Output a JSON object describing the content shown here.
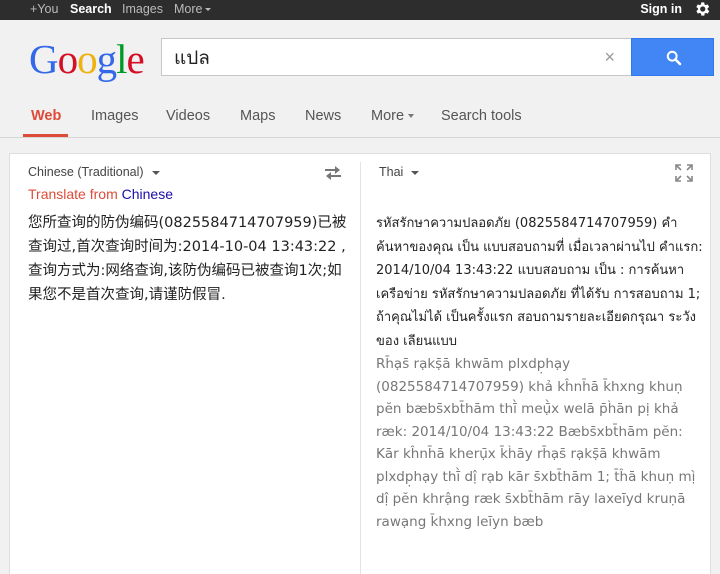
{
  "topbar": {
    "items": [
      "+You",
      "Search",
      "Images",
      "More"
    ],
    "signin": "Sign in"
  },
  "logo": {
    "letters": [
      {
        "char": "G",
        "color": "#3369e8"
      },
      {
        "char": "o",
        "color": "#d50f25"
      },
      {
        "char": "o",
        "color": "#eeb211"
      },
      {
        "char": "g",
        "color": "#3369e8"
      },
      {
        "char": "l",
        "color": "#009925"
      },
      {
        "char": "e",
        "color": "#d50f25"
      }
    ]
  },
  "search": {
    "query": "แปล",
    "clear_glyph": "×",
    "button_icon": "magnifier-icon"
  },
  "tabs": {
    "items": [
      "Web",
      "Images",
      "Videos",
      "Maps",
      "News",
      "More",
      "Search tools"
    ],
    "active": "Web"
  },
  "translate": {
    "source_language": "Chinese (Traditional)",
    "target_language": "Thai",
    "translate_from_prefix": "Translate from",
    "translate_from_language": "Chinese",
    "source_text": "您所查询的防伪编码(0825584714707959)已被查询过,首次查询时间为:2014-10-04 13:43:22 ,查询方式为:网络查询,该防伪编码已被查询1次;如果您不是首次查询,请谨防假冒.",
    "target_text": "รหัสรักษาความปลอดภัย (0825584714707959) คำค้นหาของคุณ เป็น แบบสอบถามที่ เมื่อเวลาผ่านไป คำแรก: 2014/10/04 13:43:22 แบบสอบถาม เป็น : การค้นหาเครือข่าย รหัสรักษาความปลอดภัย ที่ได้รับ การสอบถาม 1; ถ้าคุณไม่ได้ เป็นครั้งแรก สอบถามรายละเอียดกรุณา ระวังของ เลียนแบบ",
    "transliteration": "Rh̄ạs̄ rạkṣ̄ā khwām plxdp̣hạy (0825584714707959) khả kĥnh̄ā k̄hxng khuṇ pĕn bæbs̄xbt̄hām thī̀ meụ̄̀x welā p̄h̀ān pị khả ræk: 2014/10/04 13:43:22 Bæbs̄xbt̄hām pĕn: Kār kĥnh̄ā kherụ̄x k̄h̀āy rh̄ạs̄ rạkṣ̄ā khwām plxdp̣hạy thī̀ dị̂ rạb kār s̄xbt̄hām 1; t̄ĥā khuṇ mị̀ dị̂ pĕn khrậng ræk s̄xbt̄hām rāy laxeīyd kruṇā rawạng k̄hxng leīyn bæb",
    "icons": [
      "swap-languages-icon",
      "expand-icon"
    ]
  }
}
